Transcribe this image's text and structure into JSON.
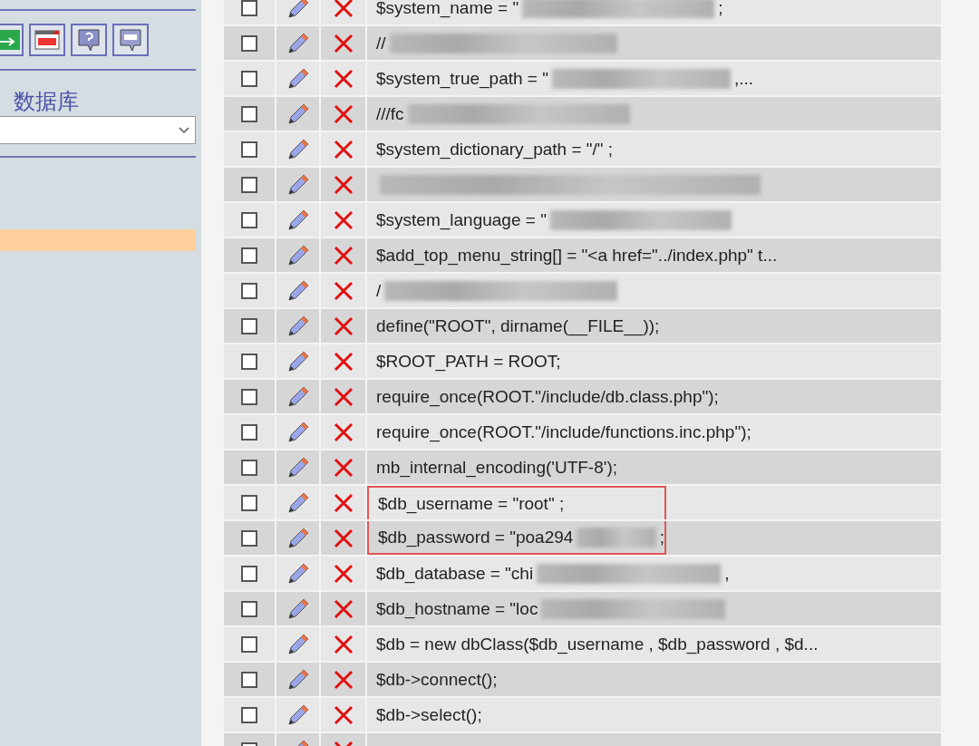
{
  "sidebar": {
    "toolbar": [
      {
        "kind": "exit"
      },
      {
        "kind": "sql-window"
      },
      {
        "kind": "help"
      },
      {
        "kind": "sql-bubble"
      }
    ],
    "database_label": "数据库"
  },
  "table": {
    "rows": [
      {
        "checked": false,
        "text": "$system_name = \"",
        "redacted": true,
        "after": ";"
      },
      {
        "checked": false,
        "text": "// ",
        "redacted": true
      },
      {
        "checked": false,
        "text": "$system_true_path = \"",
        "redacted": true,
        "after": ",..."
      },
      {
        "checked": false,
        "text": "///fc",
        "redacted": true
      },
      {
        "checked": false,
        "text": "$system_dictionary_path = \"/\" ;",
        "redacted": false
      },
      {
        "checked": false,
        "redacted": true
      },
      {
        "checked": false,
        "text": "$system_language = \"",
        "redacted": true
      },
      {
        "checked": false,
        "text": "$add_top_menu_string[] = \"<a href=\"../index.php\" t...",
        "redacted": false
      },
      {
        "checked": false,
        "text": "/",
        "redacted": true
      },
      {
        "checked": false,
        "text": "define(\"ROOT\", dirname(__FILE__));",
        "redacted": false
      },
      {
        "checked": false,
        "text": "$ROOT_PATH = ROOT;",
        "redacted": false
      },
      {
        "checked": false,
        "text": "require_once(ROOT.\"/include/db.class.php\");",
        "redacted": false
      },
      {
        "checked": false,
        "text": "require_once(ROOT.\"/include/functions.inc.php\");",
        "redacted": false
      },
      {
        "checked": false,
        "text": "mb_internal_encoding('UTF-8');",
        "redacted": false
      },
      {
        "checked": false,
        "text": "$db_username = \"root\" ;",
        "redacted": false,
        "highlighted": true
      },
      {
        "checked": false,
        "text": "$db_password = \"poa294",
        "redacted": true,
        "after": ";",
        "highlighted": true
      },
      {
        "checked": false,
        "text": "$db_database = \"chi",
        "redacted": true,
        "after": ","
      },
      {
        "checked": false,
        "text": "$db_hostname = \"loc",
        "redacted": true
      },
      {
        "checked": false,
        "text": "$db = new dbClass($db_username , $db_password , $d...",
        "redacted": false
      },
      {
        "checked": false,
        "text": "$db->connect();",
        "redacted": false
      },
      {
        "checked": false,
        "text": "$db->select();",
        "redacted": false
      },
      {
        "checked": false,
        "redacted": false
      }
    ]
  }
}
